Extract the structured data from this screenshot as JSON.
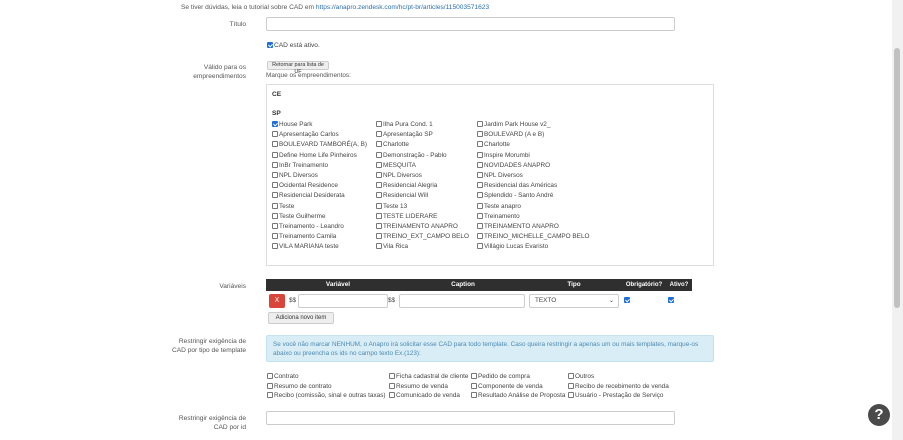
{
  "help_line": {
    "text": "Se tiver dúvidas, leia o tutorial sobre CAD em ",
    "link": "https://anapro.zendesk.com/hc/pt-br/articles/115003571623"
  },
  "titulo": {
    "label": "Título",
    "value": ""
  },
  "cad_ativo": {
    "label": "CAD está ativo.",
    "checked": true
  },
  "valido_para": {
    "label": "Válido para os empreendimentos",
    "button": "Retornar para lista de UF",
    "instruction": "Marque os empreendimentos:",
    "groups": [
      {
        "uf": "CE",
        "items": []
      },
      {
        "uf": "SP",
        "items": [
          {
            "name": "House Park",
            "checked": true
          },
          {
            "name": "Ilha Pura Cond. 1",
            "checked": false
          },
          {
            "name": "Jardim Park House v2_",
            "checked": false
          },
          {
            "name": "Apresentação Carlos",
            "checked": false
          },
          {
            "name": "Apresentação SP",
            "checked": false
          },
          {
            "name": "BOULEVARD (A e B)",
            "checked": false
          },
          {
            "name": "BOULEVARD TAMBORÉ(A, B)",
            "checked": false
          },
          {
            "name": "Charlotte",
            "checked": false
          },
          {
            "name": "Charlotte",
            "checked": false
          },
          {
            "name": "Define Home Life Pinheiros",
            "checked": false
          },
          {
            "name": "Demonstração - Pablo",
            "checked": false
          },
          {
            "name": "Inspire Morumbi",
            "checked": false
          },
          {
            "name": "InBr Treinamento",
            "checked": false
          },
          {
            "name": "MESQUITA",
            "checked": false
          },
          {
            "name": "NOVIDADES ANAPRO",
            "checked": false
          },
          {
            "name": "NPL Diversos",
            "checked": false
          },
          {
            "name": "NPL Diversos",
            "checked": false
          },
          {
            "name": "NPL Diversos",
            "checked": false
          },
          {
            "name": "Ocidental Residence",
            "checked": false
          },
          {
            "name": "Residencial Alegria",
            "checked": false
          },
          {
            "name": "Residencial das Américas",
            "checked": false
          },
          {
            "name": "Residencial Desiderata",
            "checked": false
          },
          {
            "name": "Residencial Will",
            "checked": false
          },
          {
            "name": "Splendido - Santo André",
            "checked": false
          },
          {
            "name": "Teste",
            "checked": false
          },
          {
            "name": "Teste 13",
            "checked": false
          },
          {
            "name": "Teste anapro",
            "checked": false
          },
          {
            "name": "Teste Guilherme",
            "checked": false
          },
          {
            "name": "TESTE LIDERARE",
            "checked": false
          },
          {
            "name": "Treinamento",
            "checked": false
          },
          {
            "name": "Treinamento - Leandro",
            "checked": false
          },
          {
            "name": "TREINAMENTO ANAPRO",
            "checked": false
          },
          {
            "name": "TREINAMENTO ANAPRO",
            "checked": false
          },
          {
            "name": "Treinamento Camila",
            "checked": false
          },
          {
            "name": "TREINO_EXT_CAMPO BELO",
            "checked": false
          },
          {
            "name": "TREINO_MICHELLE_CAMPO BELO",
            "checked": false
          },
          {
            "name": "VILA MARIANA teste",
            "checked": false
          },
          {
            "name": "Vila Rica",
            "checked": false
          },
          {
            "name": "Villágio Lucas Evaristo",
            "checked": false
          }
        ]
      }
    ]
  },
  "variaveis": {
    "label": "Variáveis",
    "headers": [
      "Variável",
      "Caption",
      "Tipo",
      "Obrigatório?",
      "Ativo?"
    ],
    "rows": [
      {
        "prefix1": "$$",
        "variavel": "",
        "prefix2": "$$",
        "caption": "",
        "tipo": "TEXTO",
        "obrigatorio": true,
        "ativo": true
      }
    ],
    "delete_label": "X",
    "add_button": "Adiciona novo item"
  },
  "restringir_tipo": {
    "label": "Restringir exigência de CAD por tipo de template",
    "info": "Se você não marcar NENHUM, o Anapro irá solicitar esse CAD para todo template. Caso queira restringir a apenas um ou mais templates, marque-os abaixo ou preencha os ids no campo texto Ex.(123):",
    "options": [
      "Contrato",
      "Ficha cadastral de cliente",
      "Pedido de compra",
      "Outros",
      "Resumo de contrato",
      "Resumo de venda",
      "Componente de venda",
      "Recibo de recebimento de venda",
      "Recibo (comissão, sinal e outras taxas)",
      "Comunicado de venda",
      "Resultado Análise de Proposta",
      "Usuário - Prestação de Serviço"
    ]
  },
  "restringir_id": {
    "label": "Restringir exigência de CAD por id",
    "value": ""
  },
  "help_button": "?"
}
